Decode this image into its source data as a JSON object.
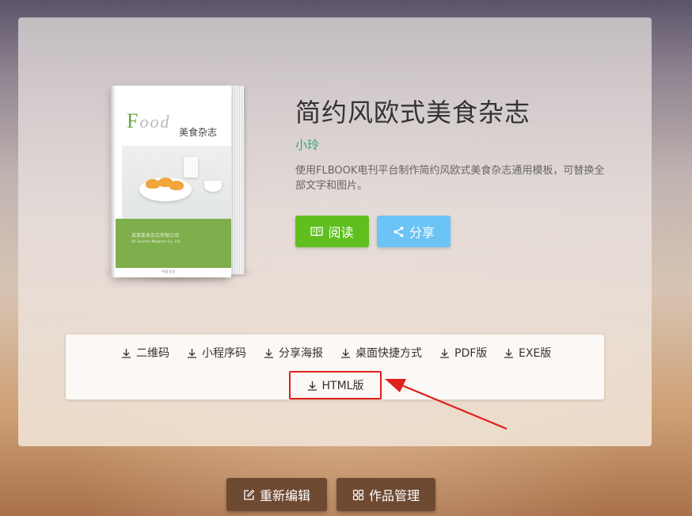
{
  "book": {
    "title": "简约风欧式美食杂志",
    "author": "小玲",
    "description": "使用FLBOOK电刊平台制作简约风欧式美食杂志通用模板，可替换全部文字和图片。",
    "cover": {
      "logo_initial": "F",
      "logo_rest": "ood",
      "title": "美食杂志",
      "company": "某某美食杂志有限公司",
      "subtitle": "XX Gourmet Magazine Co., Ltd.",
      "footer": "中国·北京"
    }
  },
  "actions": {
    "read_label": "阅读",
    "share_label": "分享"
  },
  "downloads": {
    "items": [
      "二维码",
      "小程序码",
      "分享海报",
      "桌面快捷方式",
      "PDF版",
      "EXE版"
    ],
    "html_label": "HTML版"
  },
  "footer_actions": {
    "edit_label": "重新编辑",
    "manage_label": "作品管理"
  },
  "colors": {
    "read_button": "#60bf1f",
    "share_button": "#6cc3f5",
    "author": "#2fa86f",
    "highlight_border": "#e0201b",
    "bottom_button": "#6e4a33"
  },
  "icons": {
    "read": "book-open-icon",
    "share": "share-icon",
    "download": "download-icon",
    "edit": "edit-icon",
    "manage": "grid-icon"
  }
}
